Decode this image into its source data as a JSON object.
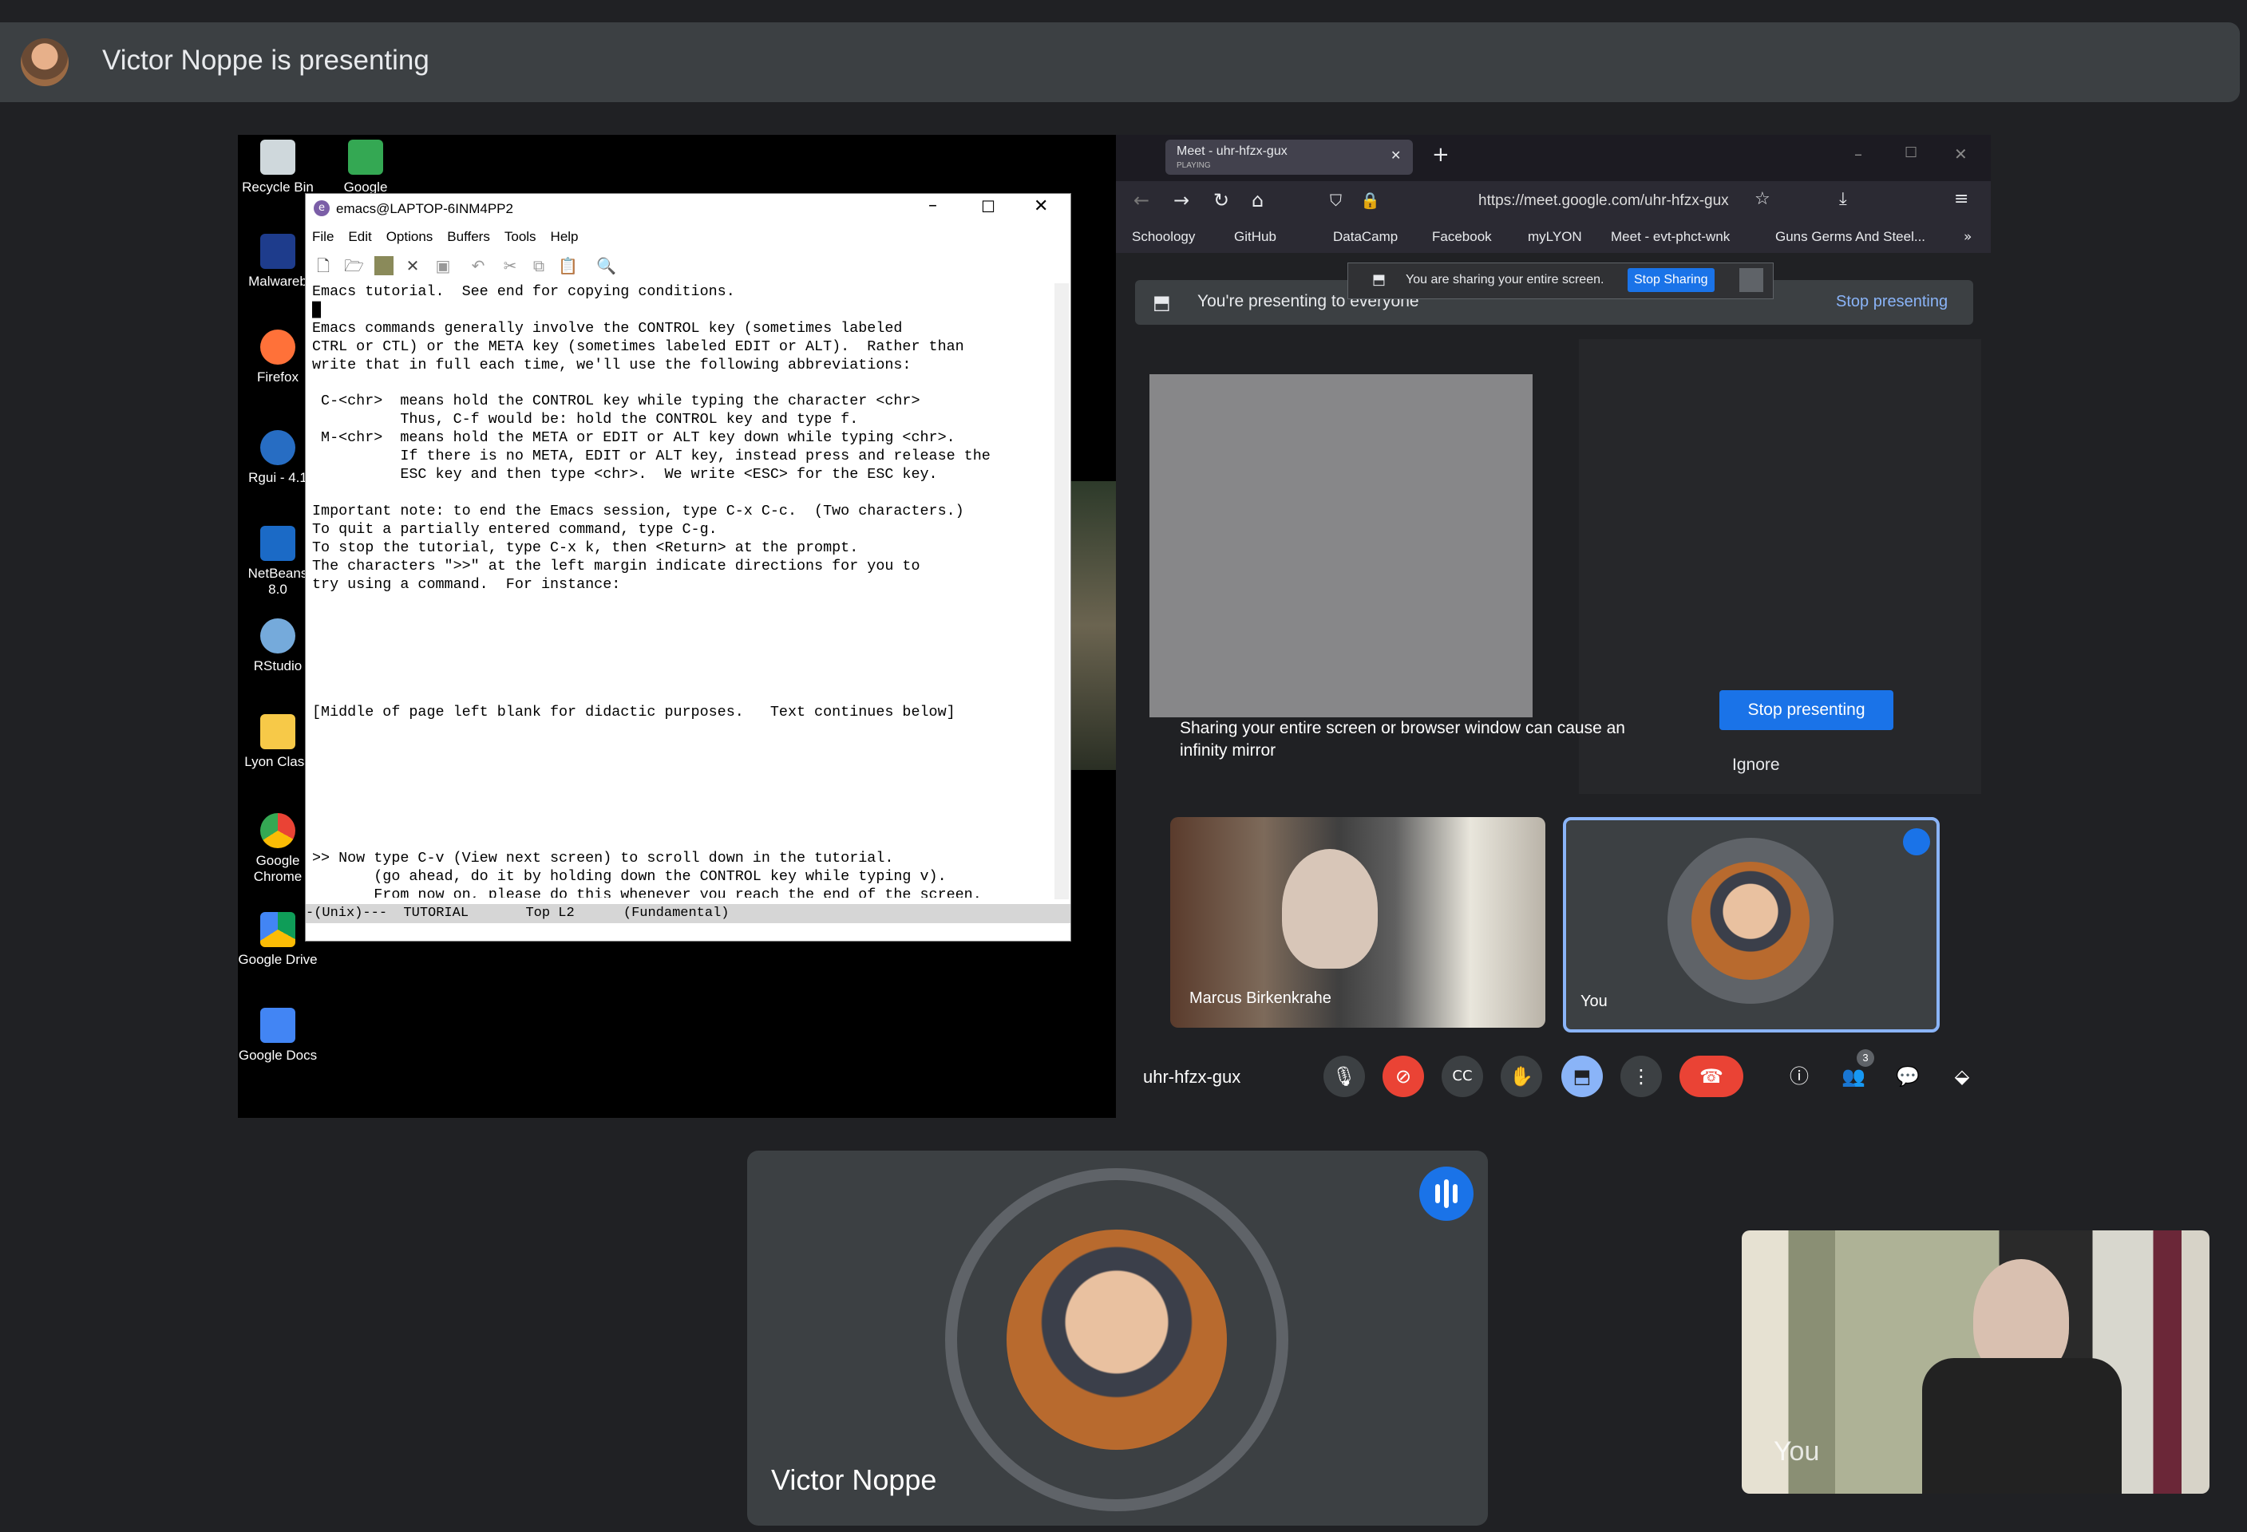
{
  "banner": {
    "text": "Victor Noppe is presenting"
  },
  "desktop_icons": [
    "Recycle Bin",
    "Google",
    "Malwareb",
    "Firefox",
    "Rgui - 4.1",
    "NetBeans",
    "8.0",
    "RStudio",
    "Lyon Class",
    "Google",
    "Chrome",
    "Google Drive",
    "Google Docs"
  ],
  "emacs": {
    "title": "emacs@LAPTOP-6INM4PP2",
    "menu": [
      "File",
      "Edit",
      "Options",
      "Buffers",
      "Tools",
      "Help"
    ],
    "lines": [
      "Emacs tutorial.  See end for copying conditions.",
      "█",
      "Emacs commands generally involve the CONTROL key (sometimes labeled",
      "CTRL or CTL) or the META key (sometimes labeled EDIT or ALT).  Rather than",
      "write that in full each time, we'll use the following abbreviations:",
      "",
      " C-<chr>  means hold the CONTROL key while typing the character <chr>",
      "          Thus, C-f would be: hold the CONTROL key and type f.",
      " M-<chr>  means hold the META or EDIT or ALT key down while typing <chr>.",
      "          If there is no META, EDIT or ALT key, instead press and release the",
      "          ESC key and then type <chr>.  We write <ESC> for the ESC key.",
      "",
      "Important note: to end the Emacs session, type C-x C-c.  (Two characters.)",
      "To quit a partially entered command, type C-g.",
      "To stop the tutorial, type C-x k, then <Return> at the prompt.",
      "The characters \">>\" at the left margin indicate directions for you to",
      "try using a command.  For instance:",
      "",
      "",
      "",
      "",
      "",
      "",
      "[Middle of page left blank for didactic purposes.   Text continues below]",
      "",
      "",
      "",
      "",
      "",
      "",
      "",
      ">> Now type C-v (View next screen) to scroll down in the tutorial.",
      "       (go ahead, do it by holding down the CONTROL key while typing v).",
      "       From now on, please do this whenever you reach the end of the screen."
    ],
    "modeline": "-(Unix)---  TUTORIAL       Top L2      (Fundamental)"
  },
  "browser": {
    "tab_title": "Meet - uhr-hfzx-gux",
    "tab_status": "PLAYING",
    "url": "https://meet.google.com/uhr-hfzx-gux",
    "bookmarks": [
      "Schoology",
      "GitHub",
      "DataCamp",
      "Facebook",
      "myLYON",
      "Meet - evt-phct-wnk",
      "Guns Germs And Steel..."
    ],
    "sharing_popup": "You are sharing your entire screen.",
    "stop_sharing": "Stop Sharing",
    "presenting_text": "You're presenting to everyone",
    "stop_presenting_link": "Stop presenting",
    "mirror_warning": "Sharing your entire screen or browser window can cause an infinity mirror",
    "stop_presenting_button": "Stop presenting",
    "ignore": "Ignore",
    "tile_marcus": "Marcus Birkenkrahe",
    "tile_you": "You",
    "meeting_code": "uhr-hfzx-gux",
    "participants_count": "3"
  },
  "bottom": {
    "main_name": "Victor Noppe",
    "self_label": "You"
  },
  "colors": {
    "accent": "#1a73e8",
    "danger": "#ea4335",
    "tile_border": "#8ab4f8"
  }
}
